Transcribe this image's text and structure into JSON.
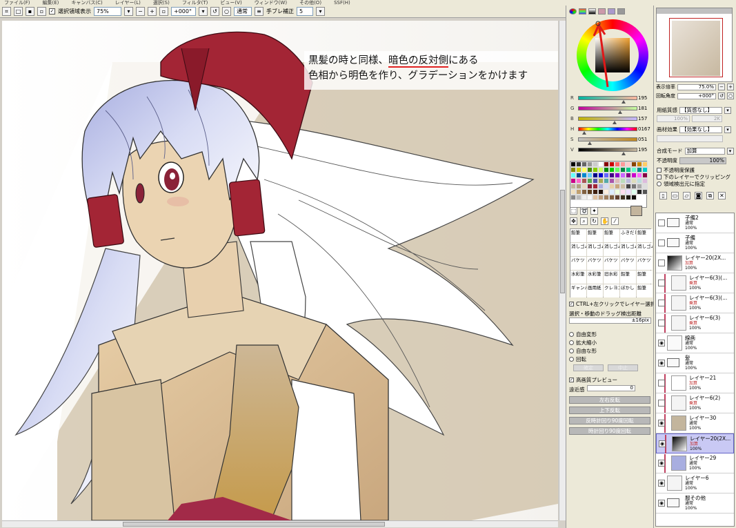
{
  "menu": [
    "ファイル(F)",
    "編集(E)",
    "キャンバス(C)",
    "レイヤー(L)",
    "選択(S)",
    "フィルタ(T)",
    "ビュー(V)",
    "ウィンドウ(W)",
    "その他(O)",
    "SSF(H)"
  ],
  "toolbar": {
    "selection_label": "選択領域表示",
    "zoom": "75%",
    "rotation": "+000°",
    "mode": "通常",
    "stabilizer_label": "手ブレ補正",
    "stabilizer_value": "5"
  },
  "caption": {
    "line1_a": "黒髪の時と同様、",
    "line1_b": "暗色の反対側",
    "line1_c": "にある",
    "line2": "色相から明色を作り、グラデーションをかけます"
  },
  "color": {
    "current_hex": "#c3b59d",
    "sliders": [
      {
        "label": "R",
        "value": "195",
        "fraction": 0.765
      },
      {
        "label": "G",
        "value": "181",
        "fraction": 0.71
      },
      {
        "label": "B",
        "value": "157",
        "fraction": 0.616
      },
      {
        "label": "H",
        "value": "0167",
        "fraction": 0.105
      },
      {
        "label": "S",
        "value": "051",
        "fraction": 0.2
      },
      {
        "label": "V",
        "value": "195",
        "fraction": 0.765
      }
    ]
  },
  "tools": {
    "brushes": [
      "鉛筆",
      "鉛筆",
      "鉛筆",
      "ふきだし",
      "鉛筆",
      "消しゴム",
      "消しゴム",
      "消しゴム",
      "消しゴム",
      "消しゴム",
      "バケツ",
      "バケツ",
      "バケツ",
      "バケツ",
      "バケツ",
      "水彩筆 9熊",
      "水彩筆 10熊",
      "旧水彩",
      "鉛筆",
      "鉛筆",
      "ギャンバス",
      "画用紙",
      "クレヨン",
      "ぼかし",
      "鉛筆"
    ],
    "ctrl_click_label": "CTRL+左クリックでレイヤー選択",
    "drag_detect_label": "選択・移動のドラッグ検出距離",
    "drag_detect_value": "±16pix",
    "transform_options": [
      "自由変形",
      "拡大縮小",
      "自由な形",
      "回転"
    ],
    "ok_button": "確定",
    "cancel_button": "中止",
    "hq_preview_label": "高画質プレビュー",
    "perspective_label": "遠近感",
    "perspective_value": "0",
    "buttons": [
      "左右反転",
      "上下反転",
      "反時計回り90度回転",
      "時計回り90度回転"
    ]
  },
  "navigator": {
    "zoom_label": "表示倍率",
    "zoom_value": "75.0%",
    "angle_label": "回転角度",
    "angle_value": "+000°"
  },
  "layer_props": {
    "texture_label": "用紙質感",
    "texture_value": "【質感なし】",
    "texture_scale": "100%",
    "texture_strength": "2K",
    "effect_label": "画材効果",
    "effect_value": "【効果なし】",
    "blend_label": "合成モード",
    "blend_value": "加算",
    "opacity_label": "不透明度",
    "opacity_value": "100%",
    "checks": [
      "不透明度保護",
      "下のレイヤーでクリッピング",
      "領域検出元に指定"
    ]
  },
  "layers": [
    {
      "name": "子備2",
      "mode": "通常",
      "opacity": "100%",
      "type": "folder",
      "visible": false,
      "clipped": false,
      "selected": false
    },
    {
      "name": "子備",
      "mode": "通常",
      "opacity": "100%",
      "type": "folder",
      "visible": false,
      "clipped": false,
      "selected": false
    },
    {
      "name": "レイヤー20(2X...",
      "mode": "加算",
      "opacity": "100%",
      "type": "grad",
      "visible": false,
      "clipped": false,
      "selected": false
    },
    {
      "name": "レイヤー6(3)(...",
      "mode": "乗算",
      "opacity": "100%",
      "type": "sketch",
      "visible": false,
      "clipped": true,
      "selected": false
    },
    {
      "name": "レイヤー6(3)(...",
      "mode": "乗算",
      "opacity": "100%",
      "type": "sketch",
      "visible": false,
      "clipped": true,
      "selected": false
    },
    {
      "name": "レイヤー6(3)",
      "mode": "乗算",
      "opacity": "100%",
      "type": "sketch",
      "visible": false,
      "clipped": true,
      "selected": false
    },
    {
      "name": "線画",
      "mode": "通常",
      "opacity": "100%",
      "type": "lines",
      "visible": true,
      "clipped": false,
      "selected": false
    },
    {
      "name": "髪",
      "mode": "通常",
      "opacity": "100%",
      "type": "folder",
      "visible": true,
      "clipped": false,
      "selected": false
    },
    {
      "name": "レイヤー21",
      "mode": "加算",
      "opacity": "100%",
      "type": "blank",
      "visible": false,
      "clipped": true,
      "selected": false
    },
    {
      "name": "レイヤー6(2)",
      "mode": "乗算",
      "opacity": "100%",
      "type": "sketch",
      "visible": false,
      "clipped": true,
      "selected": false
    },
    {
      "name": "レイヤー30",
      "mode": "通常",
      "opacity": "100%",
      "type": "beige",
      "visible": true,
      "clipped": true,
      "selected": false
    },
    {
      "name": "レイヤー20(2X...",
      "mode": "加算",
      "opacity": "100%",
      "type": "grad",
      "visible": true,
      "clipped": true,
      "selected": true
    },
    {
      "name": "レイヤー29",
      "mode": "通常",
      "opacity": "100%",
      "type": "lav",
      "visible": true,
      "clipped": true,
      "selected": false
    },
    {
      "name": "レイヤー6",
      "mode": "通常",
      "opacity": "100%",
      "type": "sketch",
      "visible": true,
      "clipped": false,
      "selected": false
    },
    {
      "name": "服その他",
      "mode": "通常",
      "opacity": "100%",
      "type": "folder",
      "visible": true,
      "clipped": false,
      "selected": false
    }
  ]
}
